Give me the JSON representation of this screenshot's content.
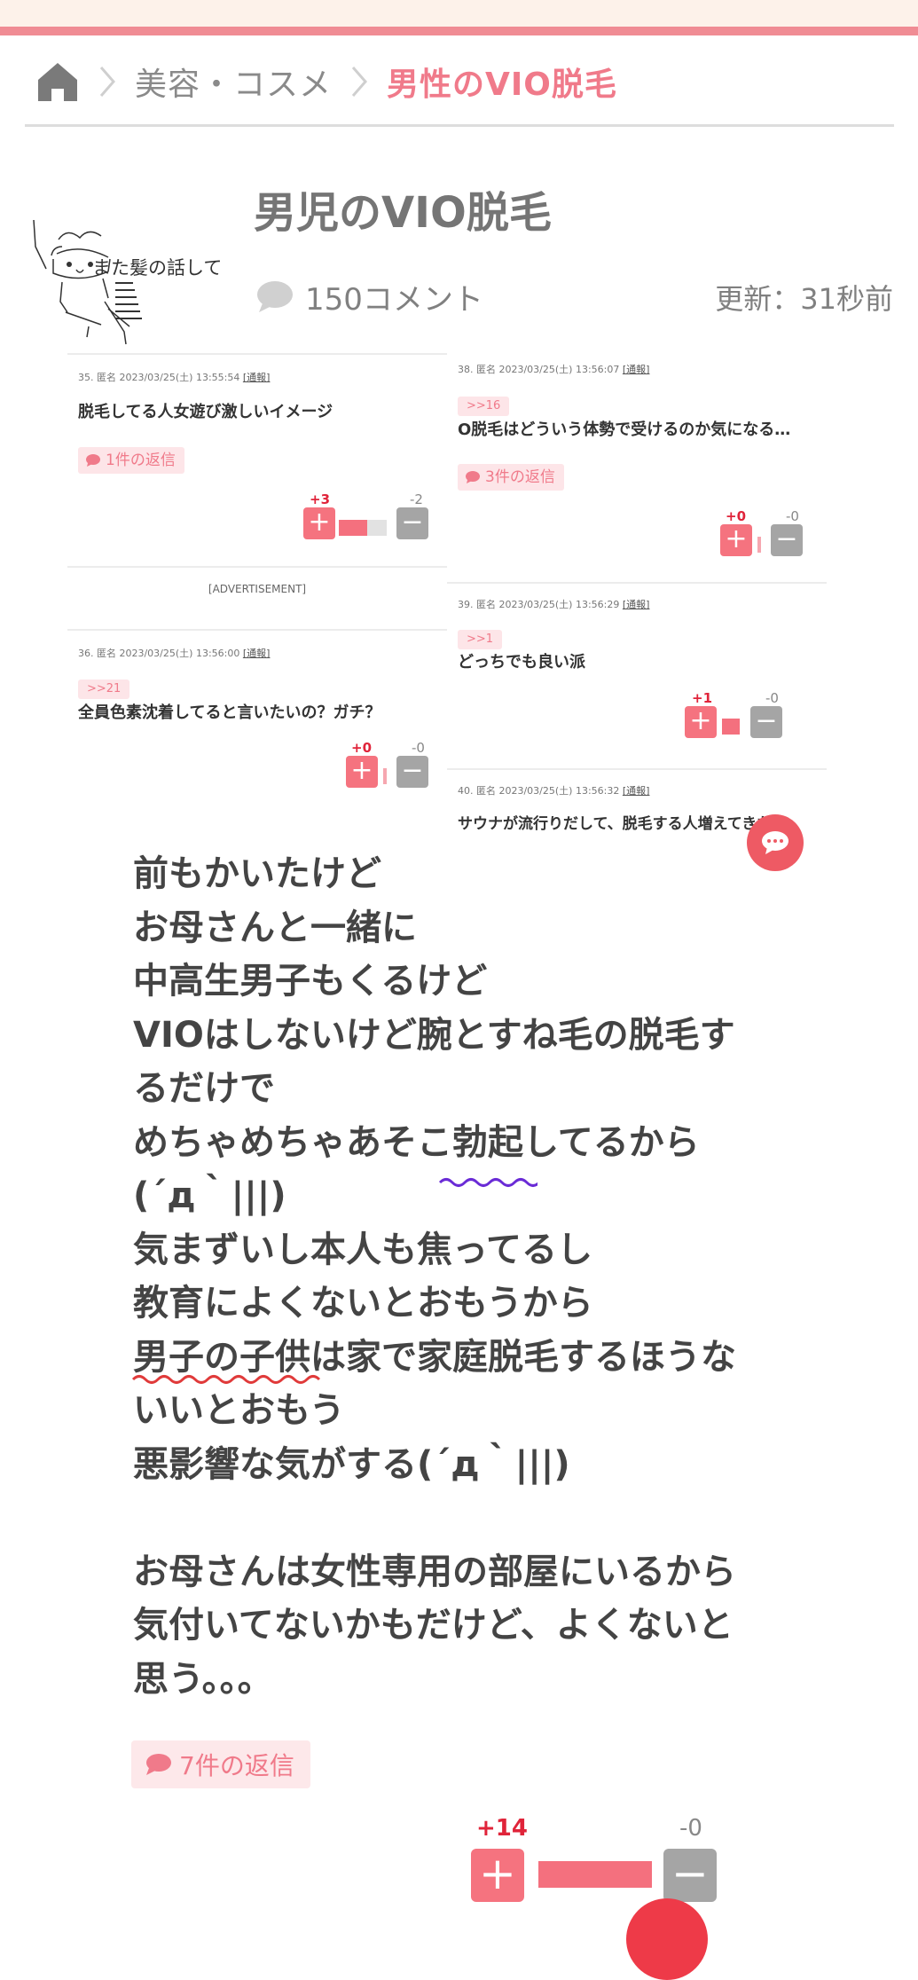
{
  "breadcrumb": {
    "home_icon": "home-icon",
    "category": "美容・コスメ",
    "current": "男性のVIO脱毛"
  },
  "header": {
    "title": "男児のVIO脱毛",
    "aa_text": "また髪の話して",
    "comment_count": "150コメント",
    "updated": "更新：31秒前"
  },
  "embedded": {
    "left": {
      "c35": {
        "meta": "35. 匿名 2023/03/25(土) 13:55:54",
        "report": "[通報]",
        "text": "脱毛してる人女遊び激しいイメージ",
        "replies": "1件の返信",
        "plus": "+3",
        "minus": "-2",
        "ratio": 0.6
      },
      "ad": "[ADVERTISEMENT]",
      "c36": {
        "meta": "36. 匿名 2023/03/25(土) 13:56:00",
        "report": "[通報]",
        "anchor": ">>21",
        "text": "全員色素沈着してると言いたいの？ガチ？",
        "plus": "+0",
        "minus": "-0",
        "ratio": 0
      }
    },
    "right": {
      "c38": {
        "meta": "38. 匿名 2023/03/25(土) 13:56:07",
        "report": "[通報]",
        "anchor": ">>16",
        "text": "O脱毛はどういう体勢で受けるのか気になる…",
        "replies": "3件の返信",
        "plus": "+0",
        "minus": "-0",
        "ratio": 0
      },
      "c39": {
        "meta": "39. 匿名 2023/03/25(土) 13:56:29",
        "report": "[通報]",
        "anchor": ">>1",
        "text": "どっちでも良い派",
        "plus": "+1",
        "minus": "-0",
        "ratio": 1
      },
      "c40": {
        "meta": "40. 匿名 2023/03/25(土) 13:56:32",
        "report": "[通報]",
        "text": "サウナが流行りだして、脱毛する人増えてきたい"
      }
    }
  },
  "main_comment": {
    "lines": [
      "前もかいたけど",
      "お母さんと一緒に",
      "中高生男子もくるけど",
      "VIOはしないけど腕とすね毛の脱毛す",
      "るだけで",
      "めちゃめちゃあそこ勃起してるから",
      "(´д｀|||)",
      "気まずいし本人も焦ってるし",
      "教育によくないとおもうから",
      "男子の子供は家で家庭脱毛するほうな",
      "いいとおもう",
      "悪影響な気がする(´д｀|||)",
      "",
      "お母さんは女性専用の部屋にいるから",
      "気付いてないかもだけど、よくないと",
      "思う。。。"
    ],
    "replies": "7件の返信",
    "plus": "+14",
    "minus": "-0",
    "ratio": 1
  },
  "colors": {
    "accent": "#f07a8a",
    "top_band": "#fdf2ea",
    "top_line": "#f08c94",
    "plus_btn": "#f5737f",
    "minus_btn": "#a5a5a5",
    "plus_count": "#e0243a"
  },
  "icons": {
    "comment": "speech-bubble-icon",
    "chevron": "chevron-right-icon",
    "fab": "chat-icon"
  }
}
